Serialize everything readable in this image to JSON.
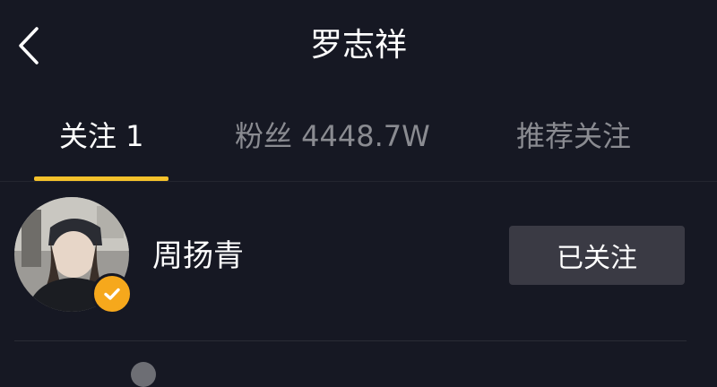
{
  "header": {
    "title": "罗志祥",
    "back_icon": "chevron-left-icon"
  },
  "tabs": [
    {
      "label": "关注 1",
      "active": true
    },
    {
      "label": "粉丝 4448.7W",
      "active": false
    },
    {
      "label": "推荐关注",
      "active": false
    }
  ],
  "following": [
    {
      "name": "周扬青",
      "verified": true,
      "button_label": "已关注"
    }
  ],
  "colors": {
    "background": "#161823",
    "accent": "#f5c12b",
    "badge": "#f6a81c",
    "button": "#3a3a44",
    "inactive_text": "#8a8b91"
  }
}
